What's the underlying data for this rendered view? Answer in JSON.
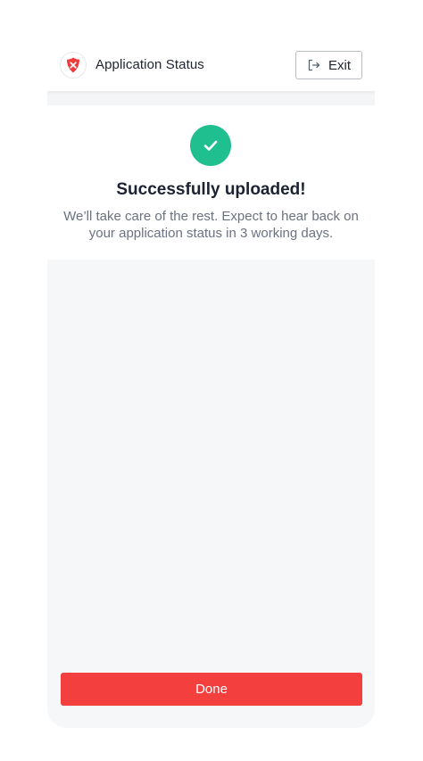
{
  "header": {
    "title": "Application Status",
    "exit_label": "Exit",
    "logo_icon": "shield-x-logo-icon",
    "exit_icon": "exit-arrow-icon"
  },
  "success": {
    "icon": "check-icon",
    "title": "Successfully uploaded!",
    "message": "We’ll take care of the rest. Expect to hear back on your application status in 3 working days."
  },
  "footer": {
    "done_label": "Done"
  },
  "colors": {
    "accent": "#f43f3f",
    "success": "#1fbf8f",
    "background": "#f6f7f9"
  }
}
